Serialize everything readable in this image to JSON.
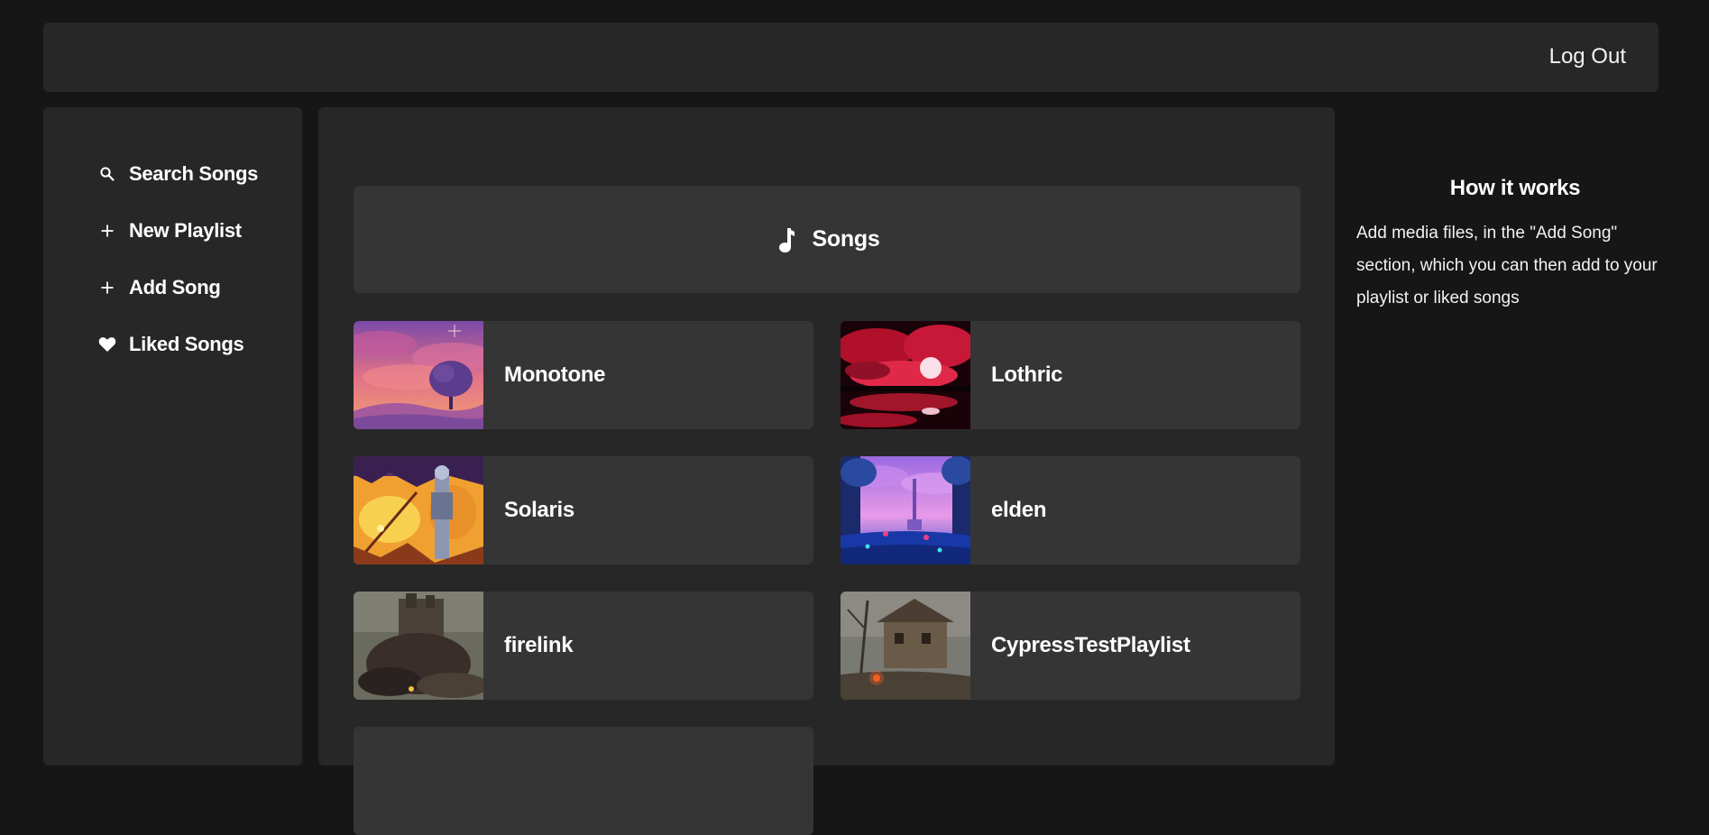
{
  "header": {
    "logout_label": "Log Out"
  },
  "sidebar": {
    "items": [
      {
        "label": "Search Songs",
        "icon": "search-icon"
      },
      {
        "label": "New Playlist",
        "icon": "plus-icon"
      },
      {
        "label": "Add Song",
        "icon": "plus-icon"
      },
      {
        "label": "Liked Songs",
        "icon": "heart-icon"
      }
    ]
  },
  "main": {
    "section_title": "Songs",
    "section_icon": "music-note-icon",
    "songs": [
      {
        "title": "Monotone"
      },
      {
        "title": "Lothric"
      },
      {
        "title": "Solaris"
      },
      {
        "title": "elden"
      },
      {
        "title": "firelink"
      },
      {
        "title": "CypressTestPlaylist"
      }
    ]
  },
  "help": {
    "title": "How it works",
    "text": "Add media files, in the \"Add Song\" section, which you can then add to your playlist or liked songs"
  },
  "colors": {
    "background": "#161616",
    "panel": "#272727",
    "card": "#353535",
    "text": "#ffffff"
  }
}
